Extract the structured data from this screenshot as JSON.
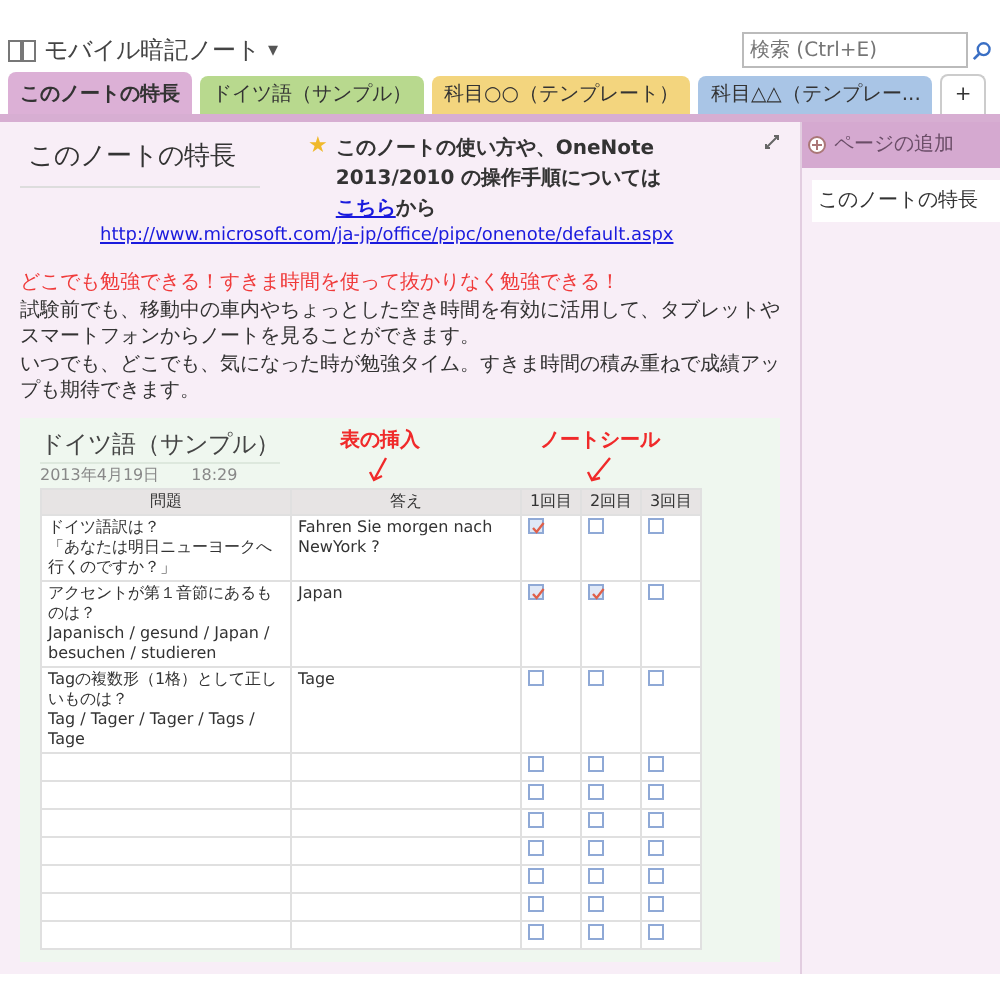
{
  "notebook": {
    "title": "モバイル暗記ノート",
    "caret": "▾"
  },
  "search": {
    "placeholder": "検索 (Ctrl+E)"
  },
  "tabs": [
    {
      "label": "このノートの特長",
      "selected": true,
      "color": "#dcb0d6"
    },
    {
      "label": "ドイツ語（サンプル）",
      "selected": false,
      "color": "#b8d98e"
    },
    {
      "label": "科目○○（テンプレート）",
      "selected": false,
      "color": "#f3d57e"
    },
    {
      "label": "科目△△（テンプレー...",
      "selected": false,
      "color": "#a9c5e6"
    }
  ],
  "new_tab": "+",
  "page": {
    "title": "このノートの特長",
    "notice": {
      "star": "★",
      "before": "このノートの使い方や、OneNote 2013/2010 の操作手順については",
      "link": "こちら",
      "after": "から"
    },
    "url": "http://www.microsoft.com/ja-jp/office/pipc/onenote/default.aspx",
    "headline": "どこでも勉強できる！すきま時間を使って抜かりなく勉強できる！",
    "body": [
      "試験前でも、移動中の車内やちょっとした空き時間を有効に活用して、タブレットやスマートフォンからノートを見ることができます。",
      "いつでも、どこでも、気になった時が勉強タイム。すきま時間の積み重ねで成績アップも期待できます。"
    ],
    "sample": {
      "title": "ドイツ語（サンプル）",
      "date": "2013年4月19日",
      "time": "18:29",
      "annotations": [
        "表の挿入",
        "ノートシール"
      ],
      "columns": [
        "問題",
        "答え",
        "1回目",
        "2回目",
        "3回目"
      ],
      "rows": [
        {
          "question": [
            "ドイツ語訳は？",
            "「あなたは明日ニューヨークへ行くのですか？」"
          ],
          "answer": "Fahren Sie morgen nach NewYork ?",
          "checks": [
            true,
            false,
            false
          ]
        },
        {
          "question": [
            "アクセントが第１音節にあるものは？",
            "Japanisch / gesund / Japan / besuchen / studieren"
          ],
          "answer": "Japan",
          "checks": [
            true,
            true,
            false
          ]
        },
        {
          "question": [
            "Tagの複数形（1格）として正しいものは？",
            "Tag / Tager / Tager / Tags / Tage"
          ],
          "answer": "Tage",
          "checks": [
            false,
            false,
            false
          ]
        },
        {
          "checks": [
            false,
            false,
            false
          ]
        },
        {
          "checks": [
            false,
            false,
            false
          ]
        },
        {
          "checks": [
            false,
            false,
            false
          ]
        },
        {
          "checks": [
            false,
            false,
            false
          ]
        },
        {
          "checks": [
            false,
            false,
            false
          ]
        },
        {
          "checks": [
            false,
            false,
            false
          ]
        },
        {
          "checks": [
            false,
            false,
            false
          ]
        }
      ]
    }
  },
  "sidebar": {
    "add_page": "ページの追加",
    "pages": [
      {
        "label": "このノートの特長",
        "selected": true
      }
    ]
  }
}
